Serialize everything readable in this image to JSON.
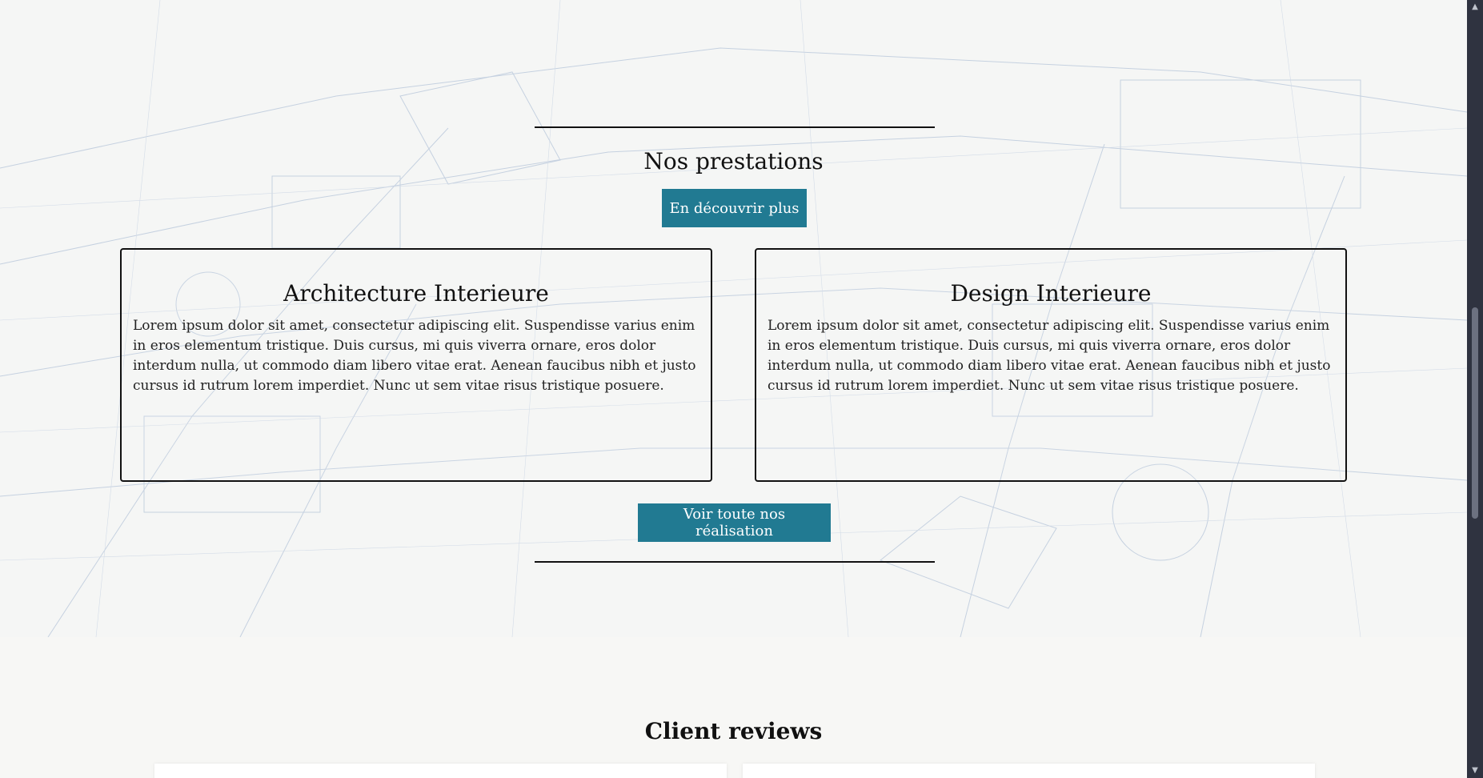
{
  "services": {
    "title": "Nos prestations",
    "discover_button": "En découvrir plus",
    "cards": [
      {
        "title": "Architecture Interieure",
        "text": "Lorem ipsum dolor sit amet, consectetur adipiscing elit. Suspendisse varius enim in eros elementum tristique. Duis cursus, mi quis viverra ornare, eros dolor interdum nulla, ut commodo diam libero vitae erat. Aenean faucibus nibh et justo cursus id rutrum lorem imperdiet. Nunc ut sem vitae risus tristique posuere."
      },
      {
        "title": "Design Interieure",
        "text": "Lorem ipsum dolor sit amet, consectetur adipiscing elit. Suspendisse varius enim in eros elementum tristique. Duis cursus, mi quis viverra ornare, eros dolor interdum nulla, ut commodo diam libero vitae erat. Aenean faucibus nibh et justo cursus id rutrum lorem imperdiet. Nunc ut sem vitae risus tristique posuere."
      }
    ],
    "realisation_button": "Voir toute nos réalisation"
  },
  "reviews": {
    "title": "Client reviews"
  },
  "scrollbar": {
    "up_icon": "chevron-up-icon",
    "down_icon": "chevron-down-icon"
  },
  "colors": {
    "accent": "#217a92",
    "scrollbar_track": "#2f3340"
  }
}
